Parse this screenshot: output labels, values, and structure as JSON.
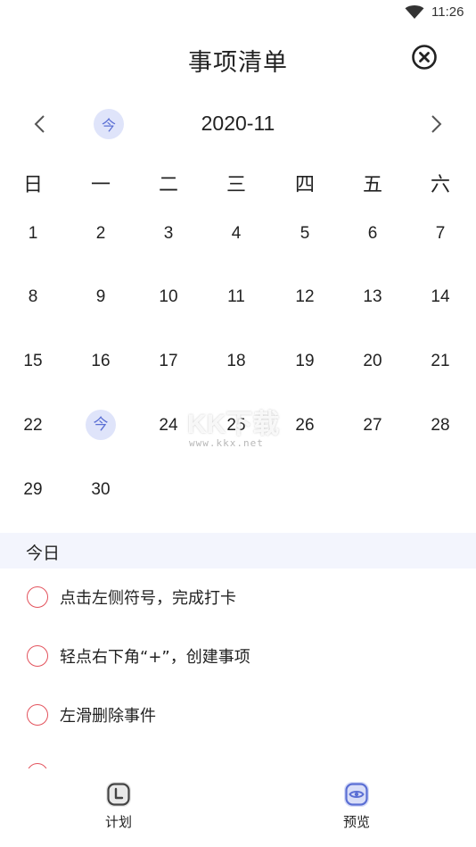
{
  "status_bar": {
    "time": "11:26"
  },
  "header": {
    "title": "事项清单"
  },
  "calendar": {
    "today_chip": "今",
    "month": "2020-11",
    "weekdays": [
      "日",
      "一",
      "二",
      "三",
      "四",
      "五",
      "六"
    ],
    "weeks": [
      [
        "1",
        "2",
        "3",
        "4",
        "5",
        "6",
        "7"
      ],
      [
        "8",
        "9",
        "10",
        "11",
        "12",
        "13",
        "14"
      ],
      [
        "15",
        "16",
        "17",
        "18",
        "19",
        "20",
        "21"
      ],
      [
        "22",
        "今",
        "24",
        "25",
        "26",
        "27",
        "28"
      ],
      [
        "29",
        "30"
      ]
    ]
  },
  "watermark": {
    "text": "KK下载",
    "url": "www.kkx.net"
  },
  "today_section": {
    "label": "今日",
    "tasks": [
      "点击左侧符号，完成打卡",
      "轻点右下角“+”，创建事项",
      "左滑删除事件"
    ]
  },
  "bottom_nav": {
    "tabs": [
      {
        "label": "计划",
        "icon": "clock-icon"
      },
      {
        "label": "预览",
        "icon": "eye-icon"
      }
    ]
  },
  "colors": {
    "accent": "#5b6fd4",
    "accent_light": "#dfe4fa",
    "task_circle": "#e3525c",
    "section_bg": "#f3f5fd"
  }
}
